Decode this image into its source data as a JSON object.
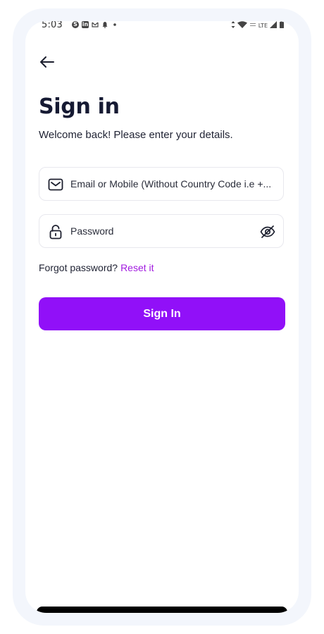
{
  "status_bar": {
    "time": "5:03",
    "left_icons": [
      "skype-icon",
      "linkedin-icon",
      "gmail-icon",
      "bell-icon",
      "dot-icon"
    ],
    "right_icons": [
      "vibrate-icon",
      "wifi-icon",
      "vowifi-icon",
      "lte-icon",
      "signal-icon",
      "battery-icon"
    ],
    "lte_label": "LTE"
  },
  "header": {
    "title": "Sign in",
    "subtitle": "Welcome back! Please enter your details."
  },
  "form": {
    "email": {
      "placeholder": "Email or Mobile (Without Country Code i.e +...",
      "value": ""
    },
    "password": {
      "placeholder": "Password",
      "value": ""
    },
    "forgot_text": "Forgot password?",
    "reset_link": "Reset it",
    "submit_label": "Sign In"
  },
  "colors": {
    "accent": "#9110f8",
    "link": "#a21ce0",
    "title": "#161a33"
  }
}
